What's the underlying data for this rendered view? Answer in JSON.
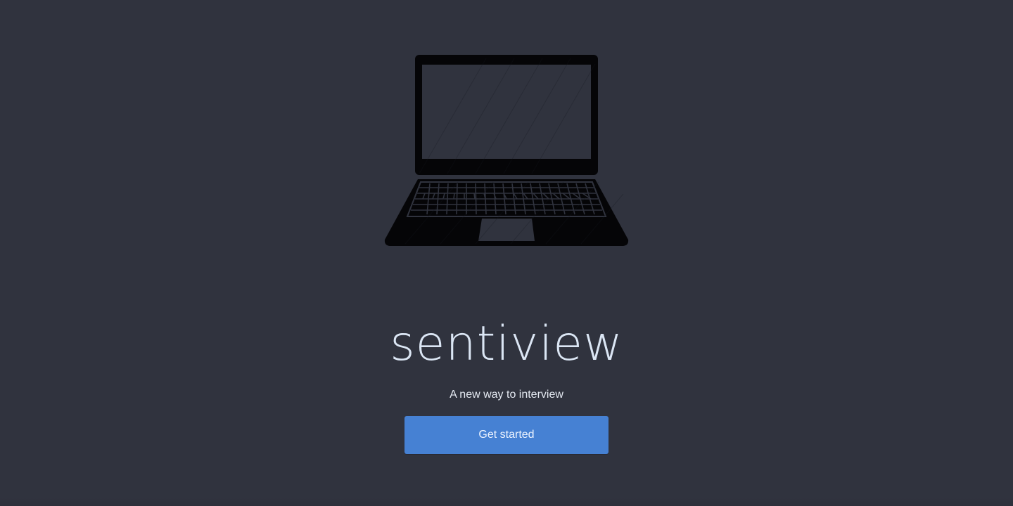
{
  "hero": {
    "icon": "laptop-icon",
    "title": "sentiview",
    "tagline": "A new way to interview",
    "cta_label": "Get started"
  },
  "colors": {
    "background": "#30333e",
    "button": "#4681d3",
    "title": "#dbe6f4",
    "laptop": "#050507"
  }
}
